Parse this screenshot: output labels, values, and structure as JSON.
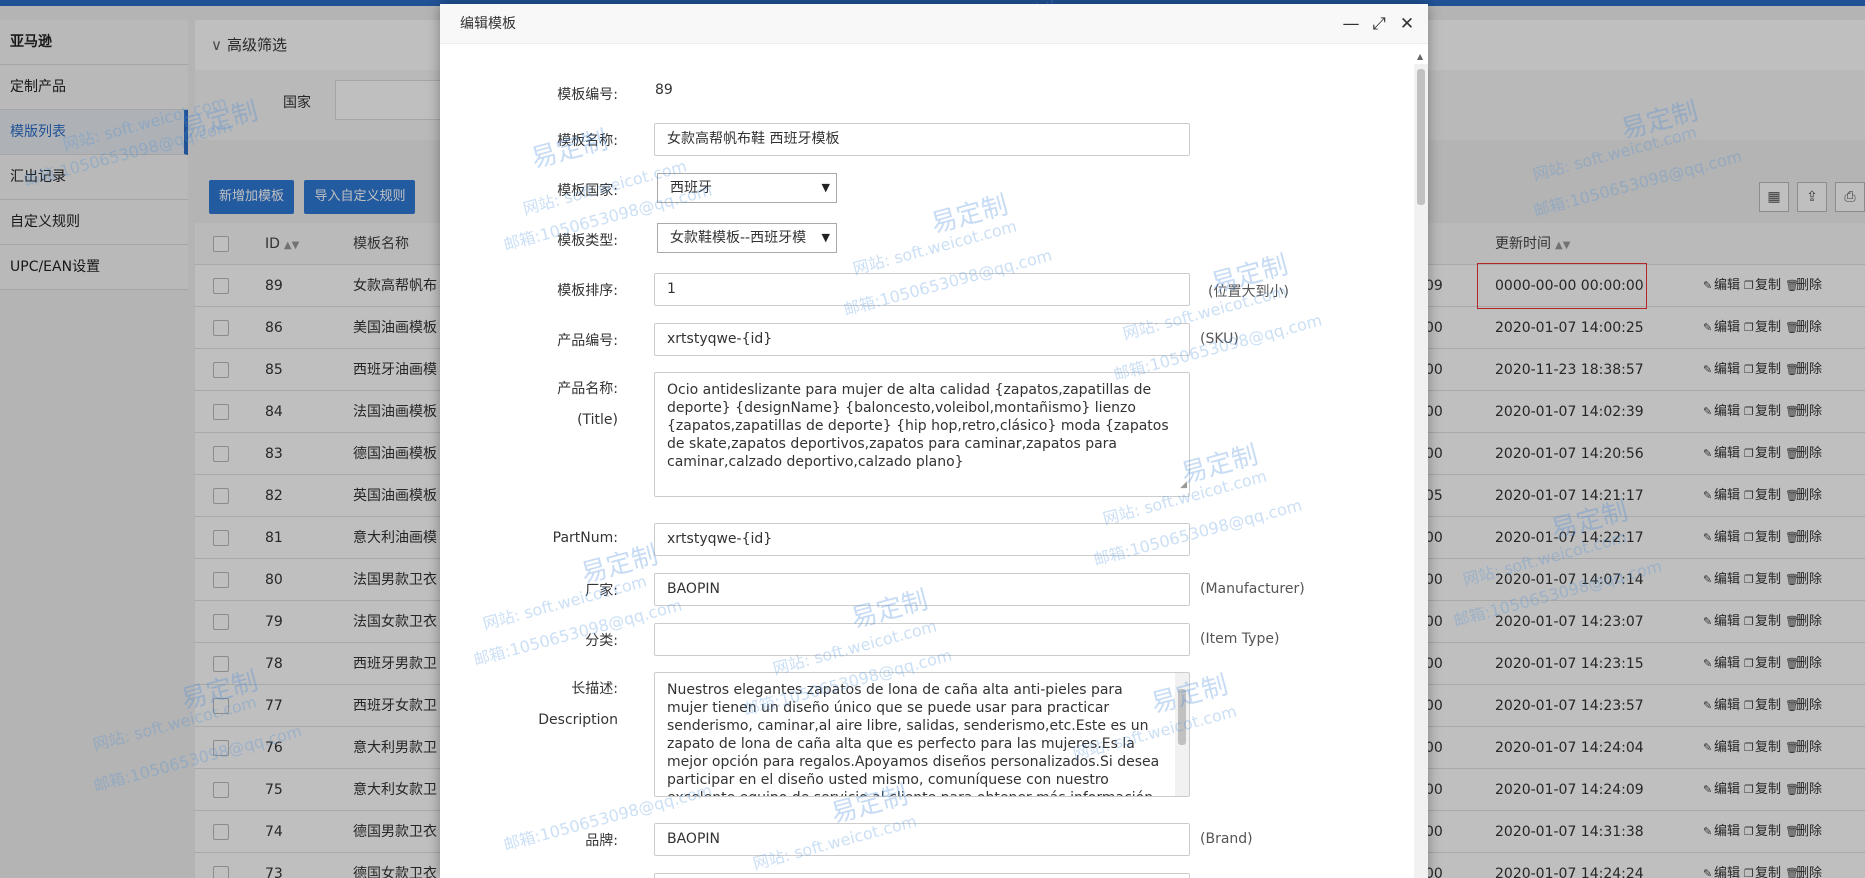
{
  "sidebar": {
    "items": [
      {
        "label": "亚马逊"
      },
      {
        "label": "定制产品"
      },
      {
        "label": "模版列表"
      },
      {
        "label": "汇出记录"
      },
      {
        "label": "自定义规则"
      },
      {
        "label": "UPC/EAN设置"
      }
    ]
  },
  "filter": {
    "title": "高级筛选",
    "country_label": "国家"
  },
  "toolbar": {
    "add_label": "新增加模板",
    "import_label": "导入自定义规则"
  },
  "table": {
    "headers": {
      "id": "ID",
      "name": "模板名称",
      "updated": "更新时间"
    },
    "ops": {
      "edit": "编辑",
      "copy": "复制",
      "delete": "删除"
    },
    "rows": [
      {
        "id": "89",
        "name": "女款高帮帆布",
        "tail": "09",
        "updated": "0000-00-00 00:00:00"
      },
      {
        "id": "86",
        "name": "美国油画模板",
        "tail": "00",
        "updated": "2020-01-07 14:00:25"
      },
      {
        "id": "85",
        "name": "西班牙油画模",
        "tail": "00",
        "updated": "2020-11-23 18:38:57"
      },
      {
        "id": "84",
        "name": "法国油画模板",
        "tail": "00",
        "updated": "2020-01-07 14:02:39"
      },
      {
        "id": "83",
        "name": "德国油画模板",
        "tail": "00",
        "updated": "2020-01-07 14:20:56"
      },
      {
        "id": "82",
        "name": "英国油画模板",
        "tail": "05",
        "updated": "2020-01-07 14:21:17"
      },
      {
        "id": "81",
        "name": "意大利油画模",
        "tail": "00",
        "updated": "2020-01-07 14:22:17"
      },
      {
        "id": "80",
        "name": "法国男款卫衣",
        "tail": "00",
        "updated": "2020-01-07 14:07:14"
      },
      {
        "id": "79",
        "name": "法国女款卫衣",
        "tail": "00",
        "updated": "2020-01-07 14:23:07"
      },
      {
        "id": "78",
        "name": "西班牙男款卫",
        "tail": "00",
        "updated": "2020-01-07 14:23:15"
      },
      {
        "id": "77",
        "name": "西班牙女款卫",
        "tail": "00",
        "updated": "2020-01-07 14:23:57"
      },
      {
        "id": "76",
        "name": "意大利男款卫",
        "tail": "00",
        "updated": "2020-01-07 14:24:04"
      },
      {
        "id": "75",
        "name": "意大利女款卫",
        "tail": "00",
        "updated": "2020-01-07 14:24:09"
      },
      {
        "id": "74",
        "name": "德国男款卫衣",
        "tail": "00",
        "updated": "2020-01-07 14:31:38"
      },
      {
        "id": "73",
        "name": "德国女款卫衣",
        "tail": "00",
        "updated": "2020-01-07 14:24:24"
      }
    ]
  },
  "modal": {
    "title": "编辑模板",
    "fields": {
      "template_no_label": "模板编号:",
      "template_no_value": "89",
      "template_name_label": "模板名称:",
      "template_name_value": "女款高帮帆布鞋 西班牙模板",
      "country_label": "模板国家:",
      "country_value": "西班牙",
      "type_label": "模板类型:",
      "type_value": "女款鞋模板--西班牙模",
      "sort_label": "模板排序:",
      "sort_value": "1",
      "sort_note": "(位置大到小)",
      "sku_label": "产品编号:",
      "sku_value": "xrtstyqwe-{id}",
      "sku_note": "(SKU)",
      "product_name_label": "产品名称:",
      "product_name_sub": "(Title)",
      "product_name_value": "Ocio antideslizante para mujer de alta calidad {zapatos,zapatillas de deporte} {designName} {baloncesto,voleibol,montañismo} lienzo {zapatos,zapatillas de deporte} {hip hop,retro,clásico} moda {zapatos de skate,zapatos deportivos,zapatos para caminar,zapatos para caminar,calzado deportivo,calzado plano}",
      "partnum_label": "PartNum:",
      "partnum_value": "xrtstyqwe-{id}",
      "manufacturer_label": "厂家:",
      "manufacturer_value": "BAOPIN",
      "manufacturer_note": "(Manufacturer)",
      "category_label": "分类:",
      "category_value": "",
      "category_note": "(Item Type)",
      "desc_label": "长描述:",
      "desc_sub": "Description",
      "desc_value": "Nuestros elegantes zapatos de lona de caña alta anti-pieles para mujer tienen un diseño único que se puede usar para practicar senderismo, caminar,al aire libre, salidas, senderismo,etc.Este es un zapato de lona de caña alta que es perfecto para las mujeres.Es la mejor opción para regalos.Apoyamos diseños personalizados.Si desea participar en el diseño usted mismo, comuníquese con nuestro excelente equipo de servicio al cliente para obtener más información.",
      "brand_label": "品牌:",
      "brand_value": "BAOPIN",
      "brand_note": "(Brand)"
    }
  },
  "watermarks": {
    "big": "易定制",
    "site": "网站: soft.weicot.com",
    "email": "邮箱:1050653098@qq.com"
  },
  "colors": {
    "accent": "#2f7ad6",
    "highlight_border": "#ee3333"
  }
}
